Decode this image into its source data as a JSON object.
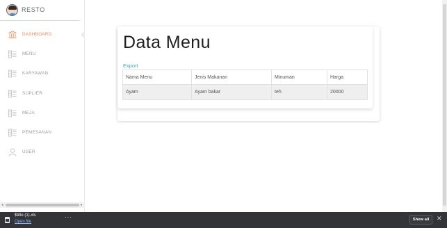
{
  "brand": {
    "name": "RESTO"
  },
  "sidebar": {
    "items": [
      {
        "label": "DASHBOARD",
        "icon": "bank-icon",
        "active": true
      },
      {
        "label": "MENU",
        "icon": "list-icon",
        "active": false
      },
      {
        "label": "KARYAWAN",
        "icon": "list-icon",
        "active": false
      },
      {
        "label": "SUPLIER",
        "icon": "list-icon",
        "active": false
      },
      {
        "label": "MEJA",
        "icon": "list-icon",
        "active": false
      },
      {
        "label": "PEMESANAN",
        "icon": "list-icon",
        "active": false
      },
      {
        "label": "USER",
        "icon": "user-icon",
        "active": false
      }
    ]
  },
  "main": {
    "title": "Data Menu",
    "export_label": "Export",
    "table": {
      "headers": [
        "Nama Menu",
        "Jenis Makanan",
        "Minuman",
        "Harga"
      ],
      "rows": [
        [
          "Ayam",
          "Ayam bakar",
          "teh",
          "20000"
        ]
      ]
    }
  },
  "download_bar": {
    "file_name": "$title (1).xls",
    "open_label": "Open file",
    "more_label": "···",
    "show_all_label": "Show all",
    "close_label": "✕"
  },
  "colors": {
    "accent": "#e8895a",
    "link": "#4aa8c8",
    "muted_text": "#9a9a9a",
    "download_bar_bg": "#333437"
  }
}
